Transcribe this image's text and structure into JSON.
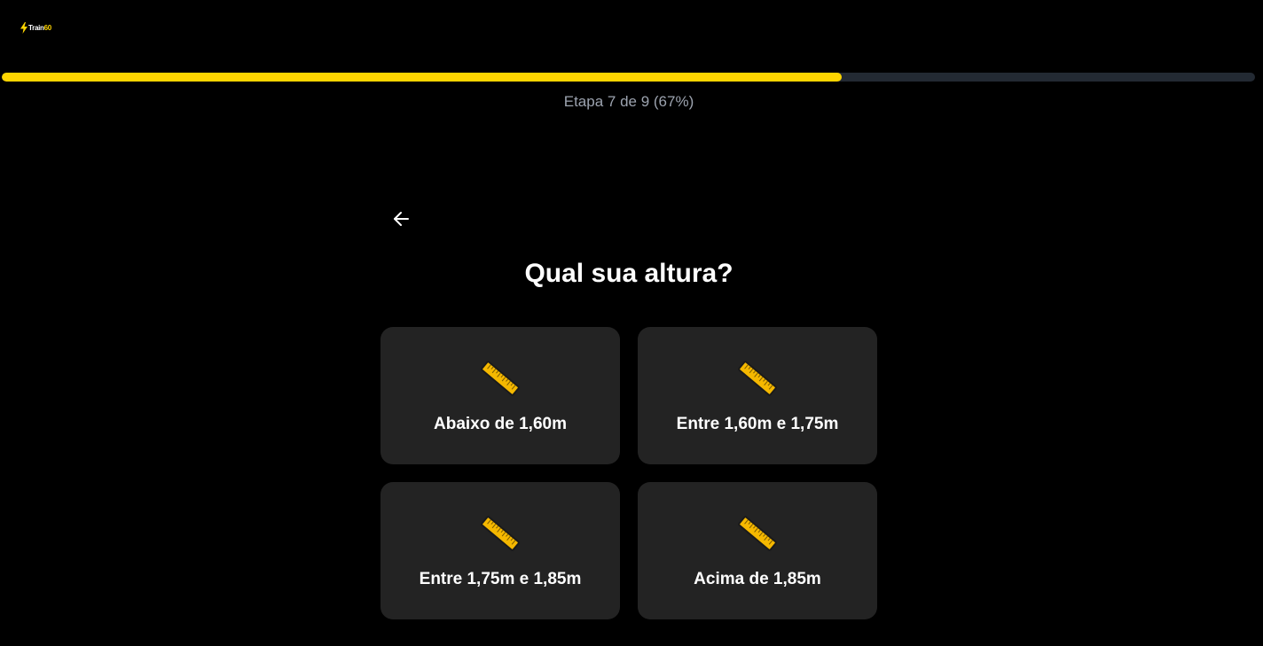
{
  "brand": {
    "logo_text_main": "Train",
    "logo_text_accent": "60",
    "logo_icon": "lightning-bolt-icon",
    "accent_color": "#FFD500"
  },
  "progress": {
    "fraction": 0.67,
    "label": "Etapa 7 de 9 (67%)"
  },
  "navigation": {
    "back_icon": "arrow-left-icon"
  },
  "question": {
    "title": "Qual sua altura?"
  },
  "options": [
    {
      "icon": "ruler-icon",
      "label": "Abaixo de 1,60m"
    },
    {
      "icon": "ruler-icon",
      "label": "Entre 1,60m e 1,75m"
    },
    {
      "icon": "ruler-icon",
      "label": "Entre 1,75m e 1,85m"
    },
    {
      "icon": "ruler-icon",
      "label": "Acima de 1,85m"
    }
  ]
}
